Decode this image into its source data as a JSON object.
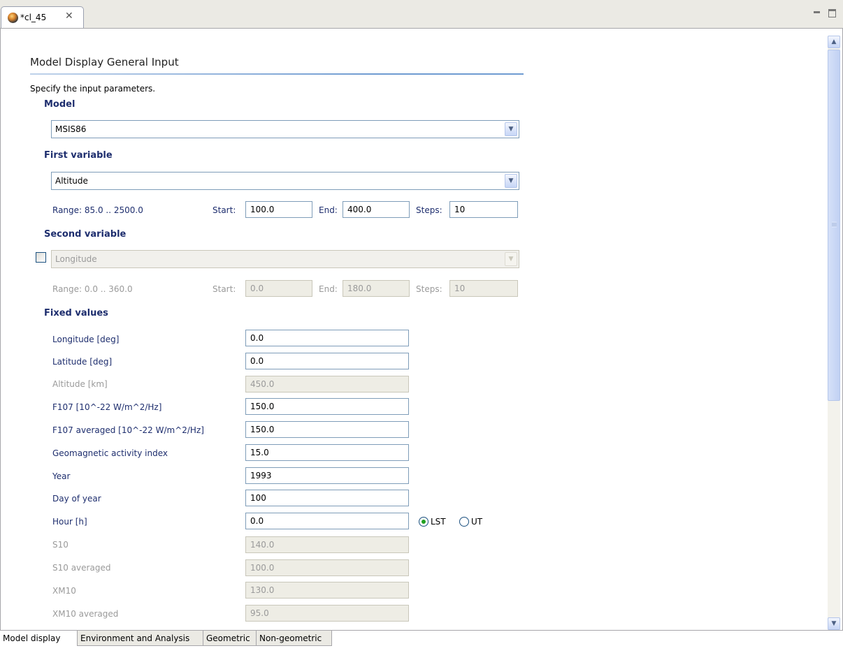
{
  "editor": {
    "tab_title": "*cl_45",
    "close_glyph": "✕"
  },
  "form": {
    "title": "Model Display General Input",
    "description": "Specify the input parameters."
  },
  "model": {
    "heading": "Model",
    "value": "MSIS86"
  },
  "first_variable": {
    "heading": "First variable",
    "value": "Altitude",
    "range": "Range: 85.0 .. 2500.0",
    "start_label": "Start:",
    "start": "100.0",
    "end_label": "End:",
    "end": "400.0",
    "steps_label": "Steps:",
    "steps": "10"
  },
  "second_variable": {
    "heading": "Second variable",
    "enabled": false,
    "value": "Longitude",
    "range": "Range: 0.0 .. 360.0",
    "start_label": "Start:",
    "start": "0.0",
    "end_label": "End:",
    "end": "180.0",
    "steps_label": "Steps:",
    "steps": "10"
  },
  "fixed_values": {
    "heading": "Fixed values",
    "rows": [
      {
        "label": "Longitude [deg]",
        "value": "0.0",
        "enabled": true
      },
      {
        "label": "Latitude [deg]",
        "value": "0.0",
        "enabled": true
      },
      {
        "label": "Altitude [km]",
        "value": "450.0",
        "enabled": false
      },
      {
        "label": "F107 [10^-22 W/m^2/Hz]",
        "value": "150.0",
        "enabled": true
      },
      {
        "label": "F107 averaged [10^-22 W/m^2/Hz]",
        "value": "150.0",
        "enabled": true
      },
      {
        "label": "Geomagnetic activity index",
        "value": "15.0",
        "enabled": true
      },
      {
        "label": "Year",
        "value": "1993",
        "enabled": true
      },
      {
        "label": "Day of year",
        "value": "100",
        "enabled": true
      },
      {
        "label": "Hour [h]",
        "value": "0.0",
        "enabled": true
      },
      {
        "label": "S10",
        "value": "140.0",
        "enabled": false
      },
      {
        "label": "S10 averaged",
        "value": "100.0",
        "enabled": false
      },
      {
        "label": "XM10",
        "value": "130.0",
        "enabled": false
      },
      {
        "label": "XM10 averaged",
        "value": "95.0",
        "enabled": false
      }
    ],
    "time_options": {
      "lst": "LST",
      "ut": "UT",
      "selected": "LST"
    }
  },
  "page_tabs": [
    "Model display",
    "Environment and Analysis",
    "Geometric",
    "Non-geometric"
  ],
  "active_page_tab": "Model display",
  "colors": {
    "section_heading": "#1e2e6e",
    "rule": "#6f9bd1",
    "radio_dot": "#21a121"
  }
}
